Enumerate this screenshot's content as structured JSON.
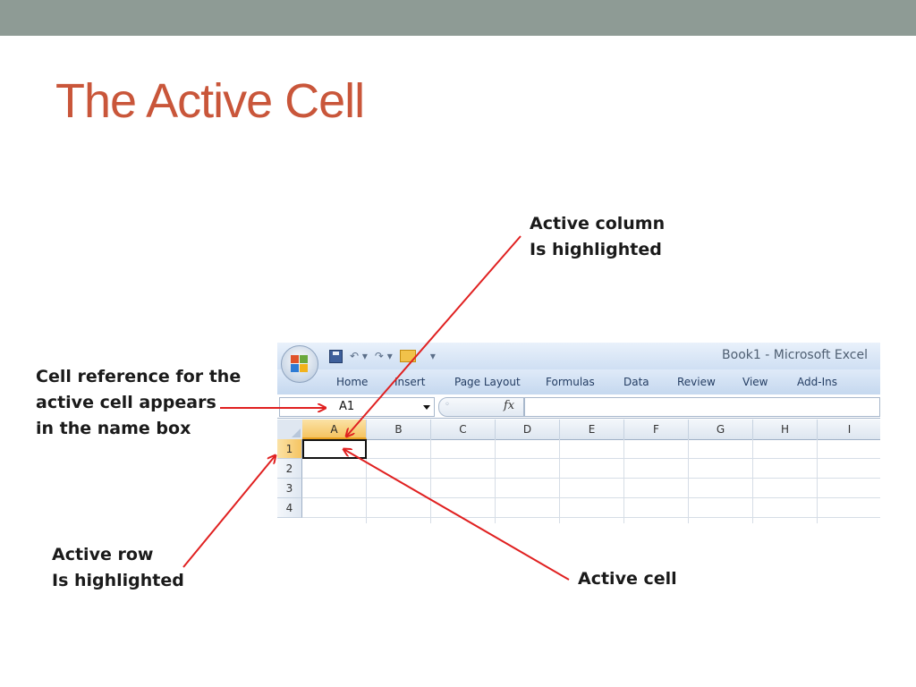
{
  "slide": {
    "title": "The Active Cell",
    "callouts": {
      "active_column": [
        "Active column",
        "Is highlighted"
      ],
      "name_box": [
        "Cell reference for the",
        "active cell appears",
        "in the name box"
      ],
      "active_row": [
        "Active row",
        "Is highlighted"
      ],
      "active_cell": "Active cell"
    }
  },
  "excel": {
    "app_title": "Book1 - Microsoft Excel",
    "ribbon_tabs": [
      "Home",
      "Insert",
      "Page Layout",
      "Formulas",
      "Data",
      "Review",
      "View",
      "Add-Ins"
    ],
    "name_box_value": "A1",
    "fx_label": "fx",
    "columns": [
      "A",
      "B",
      "C",
      "D",
      "E",
      "F",
      "G",
      "H",
      "I"
    ],
    "rows": [
      "1",
      "2",
      "3",
      "4"
    ],
    "active_column": "A",
    "active_row": "1"
  },
  "colors": {
    "title": "#c9563a",
    "arrow": "#e02020",
    "header_highlight": "#f5c462",
    "top_band": "#8e9b95"
  }
}
